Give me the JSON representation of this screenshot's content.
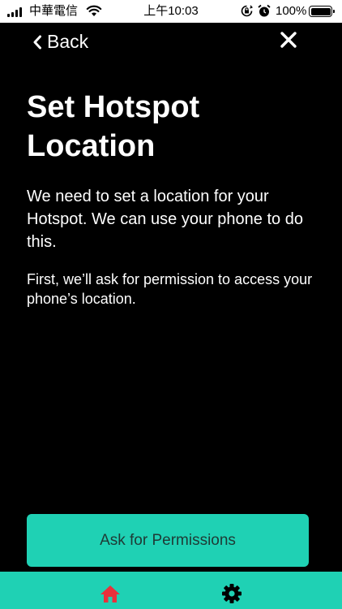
{
  "status_bar": {
    "carrier": "中華電信",
    "time": "上午10:03",
    "battery_percent": "100%"
  },
  "nav": {
    "back_label": "Back",
    "close_icon": "close-icon"
  },
  "content": {
    "title": "Set Hotspot Location",
    "intro": "We need to set a location for your Hotspot. We can use your phone to do this.",
    "permission_note": "First, we’ll ask for permission to access your phone’s location."
  },
  "primary_button": {
    "label": "Ask for Permissions"
  },
  "tab_bar": {
    "tabs": [
      {
        "icon": "home-icon",
        "active": true
      },
      {
        "icon": "gear-icon",
        "active": false
      }
    ]
  },
  "colors": {
    "accent": "#1fd1b4",
    "active_tab": "#e8323c",
    "background": "#000000"
  }
}
